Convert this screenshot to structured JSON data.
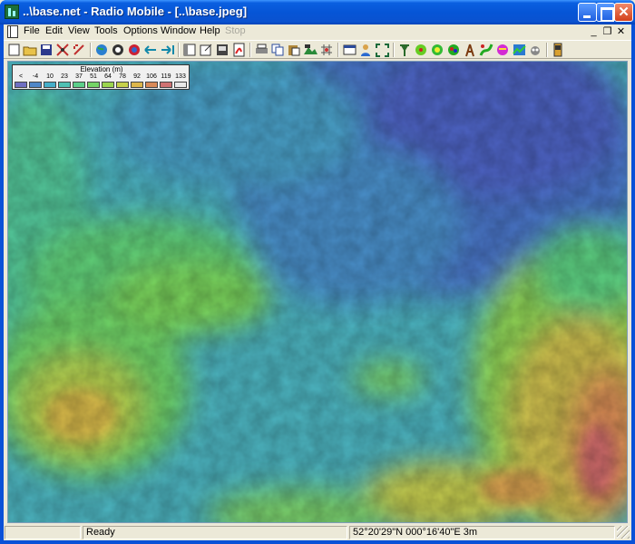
{
  "window": {
    "title": "..\\base.net - Radio Mobile - [..\\base.jpeg]"
  },
  "menu": {
    "file": "File",
    "edit": "Edit",
    "view": "View",
    "tools": "Tools",
    "options": "Options",
    "window": "Window",
    "help": "Help",
    "stop": "Stop"
  },
  "legend": {
    "title": "Elevation (m)",
    "values": [
      "<",
      "-4",
      "10",
      "23",
      "37",
      "51",
      "64",
      "78",
      "92",
      "106",
      "119",
      "133"
    ],
    "colors": [
      "#6f6fc2",
      "#4f87c8",
      "#45aec9",
      "#4ec1b3",
      "#5ccf8a",
      "#74d566",
      "#9bd64e",
      "#c6d14a",
      "#ddb64a",
      "#d98a58",
      "#cf7272",
      "#e8e8e8"
    ]
  },
  "statusbar": {
    "status": "Ready",
    "coordinates": "52°20'29\"N 000°16'40\"E 3m"
  },
  "colors": {
    "titlebar": "#0655d6",
    "chrome": "#ece9d8"
  }
}
